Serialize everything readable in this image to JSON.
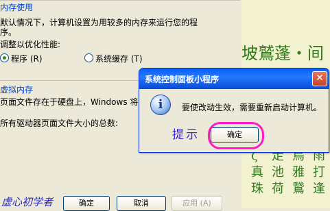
{
  "memory": {
    "section_title": "内存使用",
    "desc_line1": "默认情况下，计算机设置为用较多的内存来运行您的程",
    "desc_line2": "序。",
    "optimize_label": "调整以优化性能:",
    "option_programs": "程序 (R)",
    "option_cache": "系统缓存 (T)"
  },
  "virtual_memory": {
    "section_title": "虚拟内存",
    "line1": "页面文件存在于硬盘上，Windows 将它",
    "line2": "所有驱动器页面文件大小的总数:"
  },
  "bottom_buttons": {
    "ok": "确定",
    "cancel": "取消",
    "apply": "应用 (A)"
  },
  "watermark": "虚心初学者",
  "dialog": {
    "title": "系统控制面板小程序",
    "close": "✕",
    "message": "要使改动生效，需要重新启动计算机。",
    "ok": "确定",
    "annotation": "提示"
  },
  "background": {
    "calligraphy_row": "坡鷲蓬・间",
    "col1": "ζ 真 珠",
    "col2": "走 池 荷",
    "col3": "鳥 雅 鵞",
    "col4": "雨 打 逢"
  }
}
